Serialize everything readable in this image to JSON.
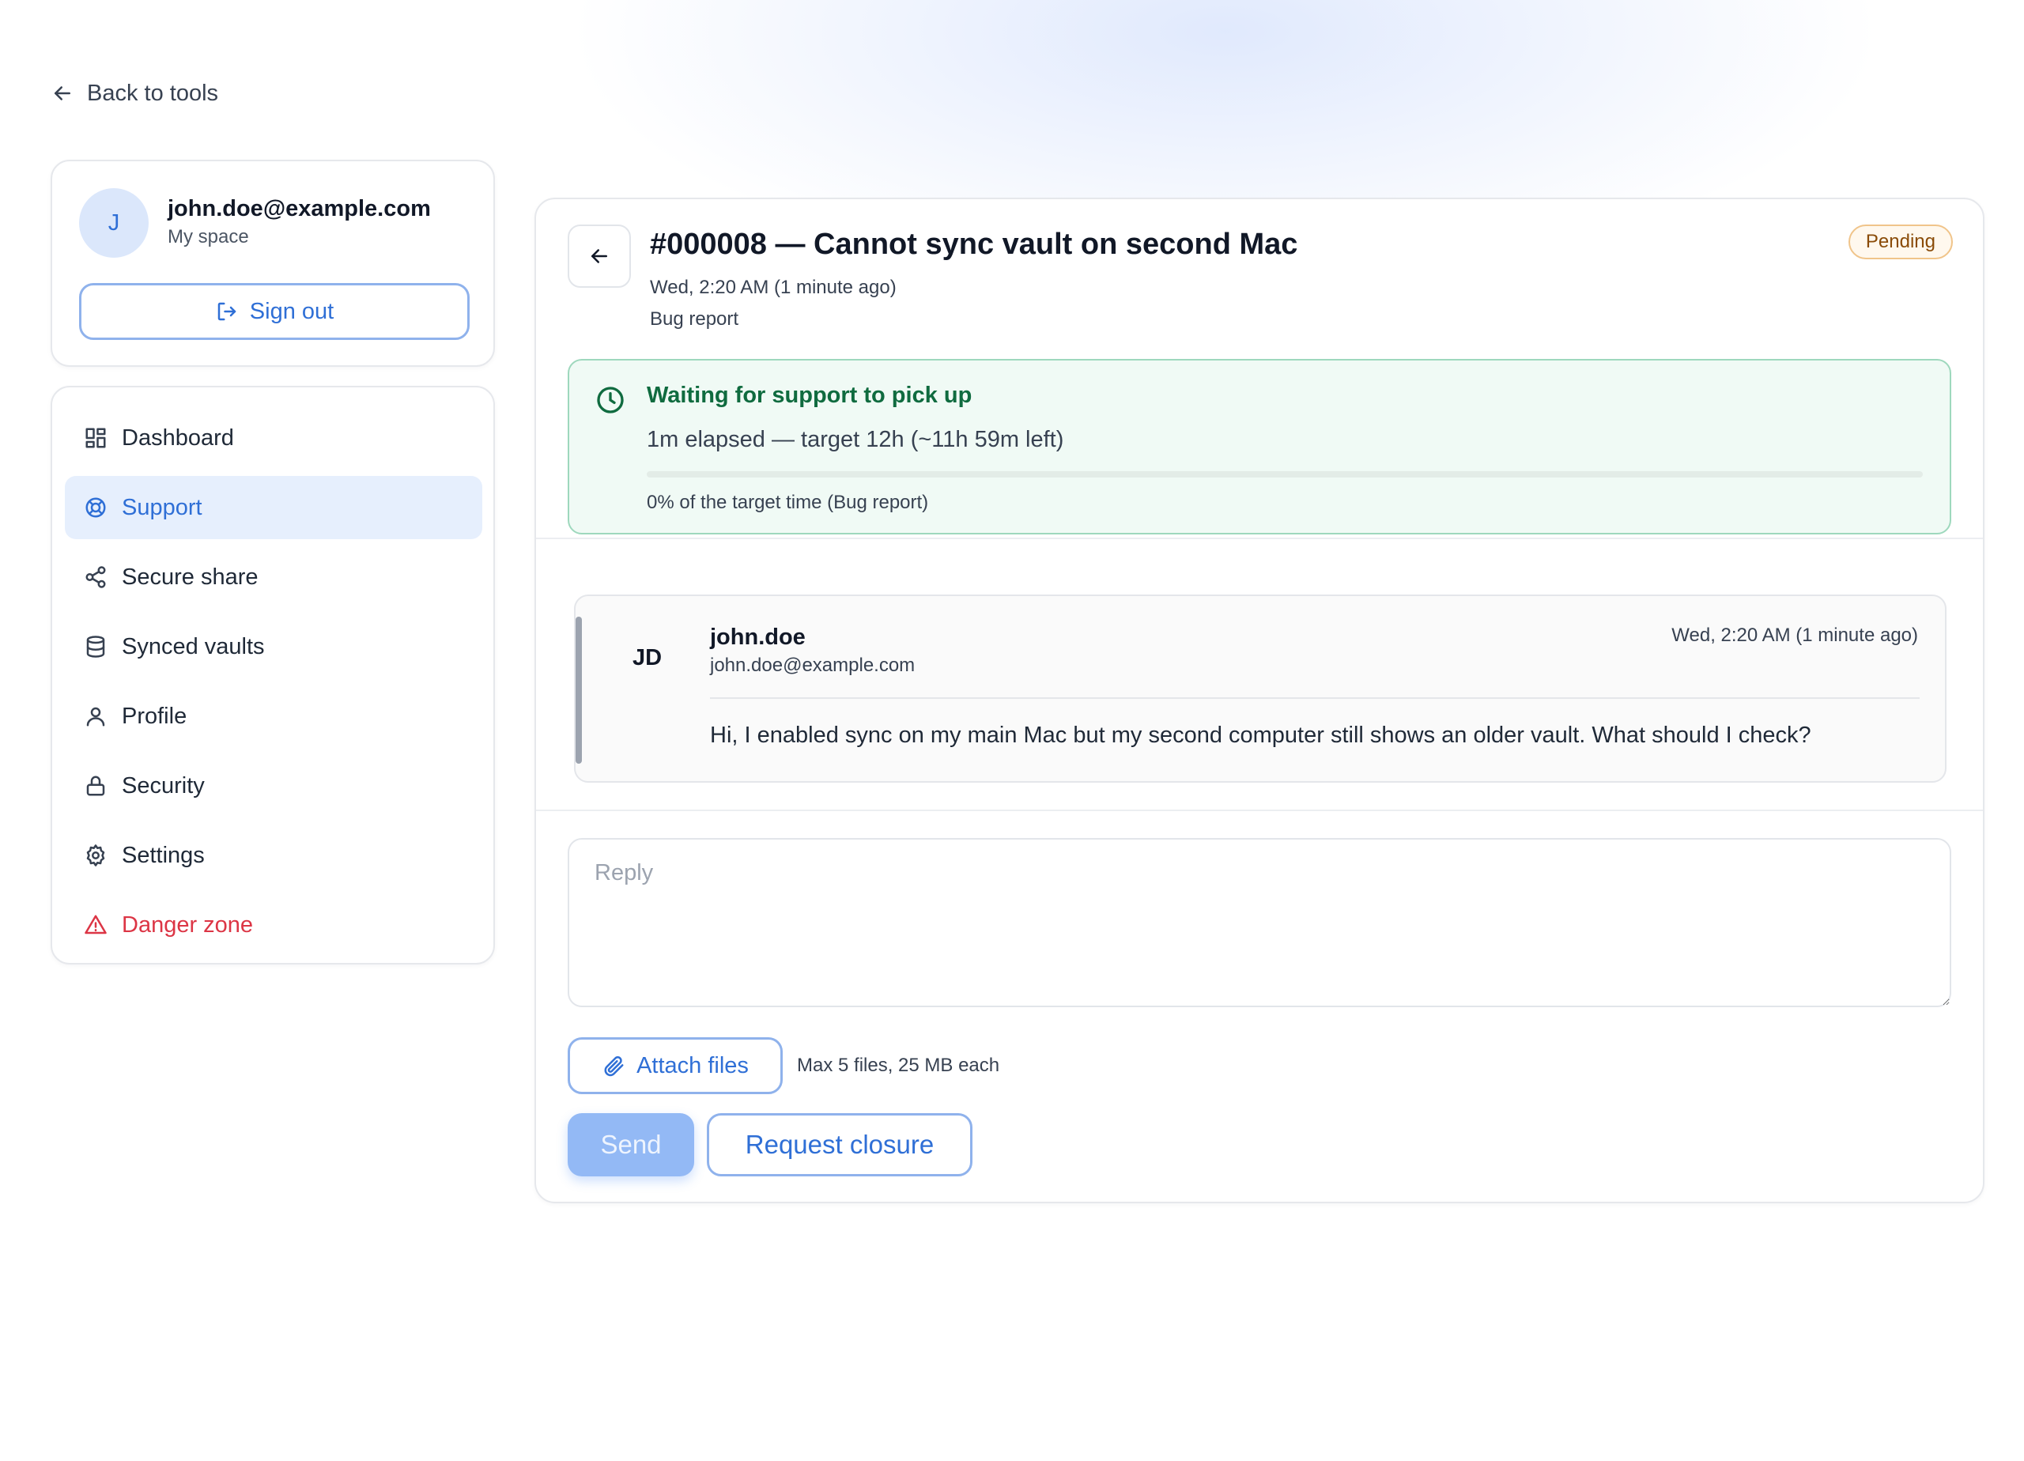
{
  "nav_back": {
    "label": "Back to tools"
  },
  "user": {
    "initial": "J",
    "email": "john.doe@example.com",
    "space": "My space",
    "sign_out_label": "Sign out"
  },
  "sidebar": {
    "items": [
      {
        "label": "Dashboard",
        "icon": "dashboard-icon"
      },
      {
        "label": "Support",
        "icon": "lifebuoy-icon",
        "active": true
      },
      {
        "label": "Secure share",
        "icon": "share-icon"
      },
      {
        "label": "Synced vaults",
        "icon": "database-icon"
      },
      {
        "label": "Profile",
        "icon": "user-icon"
      },
      {
        "label": "Security",
        "icon": "lock-icon"
      },
      {
        "label": "Settings",
        "icon": "gear-icon"
      },
      {
        "label": "Danger zone",
        "icon": "warning-icon",
        "color": "#dc3545"
      }
    ]
  },
  "ticket": {
    "title": "#000008 — Cannot sync vault on second Mac",
    "date": "Wed, 2:20 AM (1 minute ago)",
    "category": "Bug report",
    "status": "Pending"
  },
  "sla": {
    "title": "Waiting for support to pick up",
    "elapsed_text": "1m elapsed — target 12h (~11h 59m left)",
    "progress_percent": 0,
    "percent_text": "0% of the target time (Bug report)"
  },
  "messages": [
    {
      "initials": "JD",
      "author": "john.doe",
      "email": "john.doe@example.com",
      "time": "Wed, 2:20 AM (1 minute ago)",
      "body": "Hi, I enabled sync on my main Mac but my second computer still shows an older vault. What should I check?"
    }
  ],
  "reply": {
    "placeholder": "Reply",
    "value": "",
    "attach_label": "Attach files",
    "attach_hint": "Max 5 files, 25 MB each",
    "send_label": "Send",
    "request_closure_label": "Request closure"
  },
  "colors": {
    "accent": "#2f6fd6",
    "danger": "#dc3545",
    "sla_green": "#0f6b3f",
    "pending_badge": "#8a4b08"
  }
}
